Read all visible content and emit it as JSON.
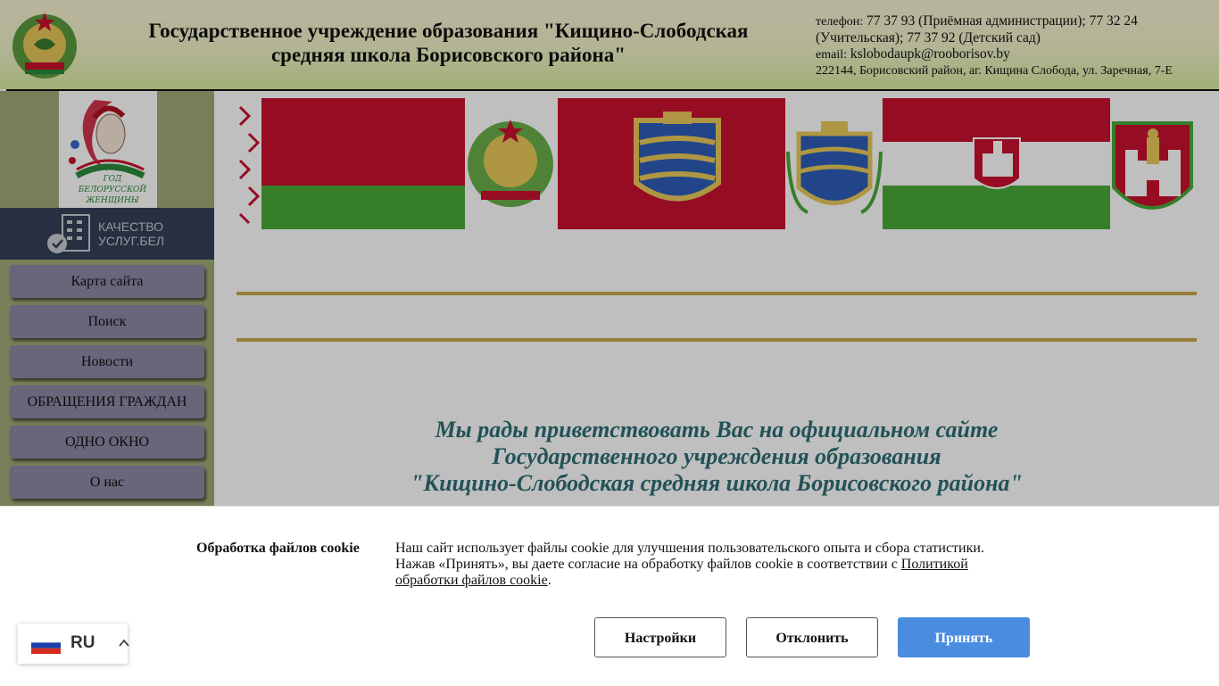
{
  "header": {
    "title": "Государственное учреждение образования \"Кищино-Слободская средняя школа Борисовского района\"",
    "phone_label": "телефон:",
    "phone_value": "77 37 93 (Приёмная администрации); 77 32 24 (Учительская); 77 37 92 (Детский сад)",
    "email_label": "email:",
    "email_value": "kslobodaupk@rooborisov.by",
    "address": "222144, Борисовский район, аг. Кищина Слобода, ул. Заречная, 7-Е"
  },
  "sidebar": {
    "year_logo_line1": "ГОД",
    "year_logo_line2": "БЕЛОРУССКОЙ",
    "year_logo_line3": "ЖЕНЩИНЫ",
    "quality_line1": "КАЧЕСТВО",
    "quality_line2": "УСЛУГ.БЕЛ",
    "items": [
      {
        "label": "Карта сайта"
      },
      {
        "label": "Поиск"
      },
      {
        "label": "Новости"
      },
      {
        "label": "ОБРАЩЕНИЯ ГРАЖДАН"
      },
      {
        "label": "ОДНО ОКНО"
      },
      {
        "label": "О нас"
      }
    ]
  },
  "main": {
    "welcome_line1": "Мы рады приветствовать Вас на официальном сайте",
    "welcome_line2": "Государственного учреждения образования",
    "welcome_line3": "\"Кищино-Слободская средняя школа Борисовского района\""
  },
  "cookie": {
    "title": "Обработка файлов cookie",
    "text_part1": "Наш сайт использует файлы cookie для улучшения пользовательского опыта и сбора статистики. Нажав «Принять», вы даете согласие на обработку файлов cookie в соответствии с ",
    "link_text": "Политикой обработки файлов cookie",
    "text_part2": ".",
    "settings_label": "Настройки",
    "reject_label": "Отклонить",
    "accept_label": "Принять"
  },
  "language": {
    "code": "RU",
    "icon": "russia-flag-icon"
  },
  "colors": {
    "accent": "#4a8de0",
    "welcome_text": "#2e6e74",
    "gold_line": "#c9a94a",
    "quality_bg": "#354056",
    "nav_button": "#8d87a3"
  }
}
